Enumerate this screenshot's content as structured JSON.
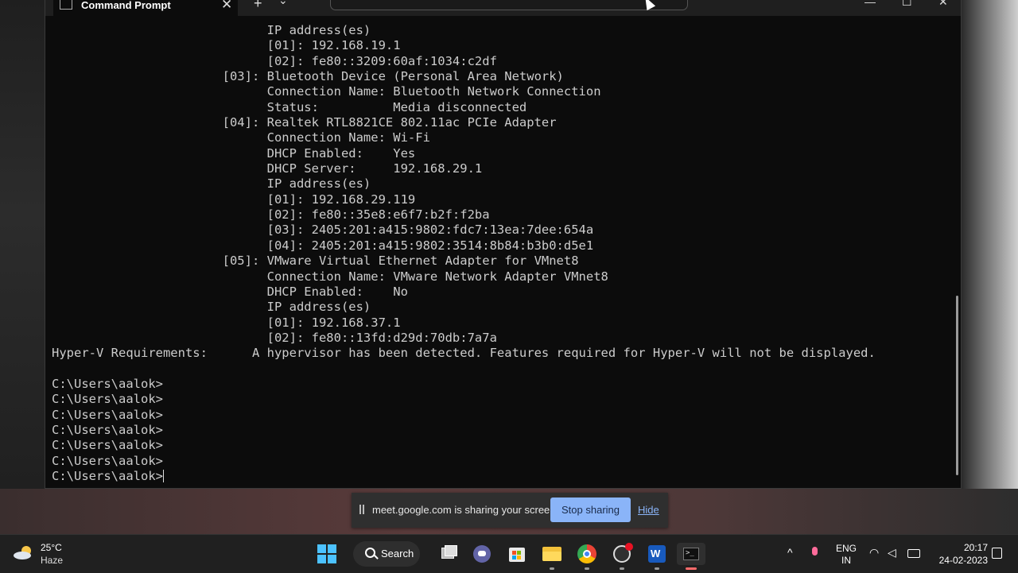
{
  "window": {
    "tab_title": "Command Prompt",
    "new_tab": "+",
    "tab_dropdown": "⌄",
    "tab_close": "✕",
    "minimize": "—",
    "maximize": "☐",
    "close": "✕"
  },
  "console": {
    "lines": [
      "                             IP address(es)",
      "                             [01]: 192.168.19.1",
      "                             [02]: fe80::3209:60af:1034:c2df",
      "                       [03]: Bluetooth Device (Personal Area Network)",
      "                             Connection Name: Bluetooth Network Connection",
      "                             Status:          Media disconnected",
      "                       [04]: Realtek RTL8821CE 802.11ac PCIe Adapter",
      "                             Connection Name: Wi-Fi",
      "                             DHCP Enabled:    Yes",
      "                             DHCP Server:     192.168.29.1",
      "                             IP address(es)",
      "                             [01]: 192.168.29.119",
      "                             [02]: fe80::35e8:e6f7:b2f:f2ba",
      "                             [03]: 2405:201:a415:9802:fdc7:13ea:7dee:654a",
      "                             [04]: 2405:201:a415:9802:3514:8b84:b3b0:d5e1",
      "                       [05]: VMware Virtual Ethernet Adapter for VMnet8",
      "                             Connection Name: VMware Network Adapter VMnet8",
      "                             DHCP Enabled:    No",
      "                             IP address(es)",
      "                             [01]: 192.168.37.1",
      "                             [02]: fe80::13fd:d29d:70db:7a7a",
      "Hyper-V Requirements:      A hypervisor has been detected. Features required for Hyper-V will not be displayed.",
      "",
      "C:\\Users\\aalok>",
      "C:\\Users\\aalok>",
      "C:\\Users\\aalok>",
      "C:\\Users\\aalok>",
      "C:\\Users\\aalok>",
      "C:\\Users\\aalok>",
      "C:\\Users\\aalok>"
    ]
  },
  "share_bar": {
    "message": "meet.google.com is sharing your screen.",
    "stop_label": "Stop sharing",
    "hide_label": "Hide"
  },
  "taskbar": {
    "weather_temp": "25°C",
    "weather_condition": "Haze",
    "search_label": "Search",
    "apps": [
      "file-explorer-window-icon",
      "teams-chat-icon",
      "microsoft-store-icon",
      "file-explorer-icon",
      "chrome-icon",
      "obs-icon",
      "word-icon",
      "terminal-icon"
    ],
    "language": "ENG",
    "region": "IN",
    "time": "20:17",
    "date": "24-02-2023"
  },
  "colors": {
    "console_bg": "#0c0c0c",
    "console_text": "#cccccc",
    "accent": "#8ab4f8"
  }
}
